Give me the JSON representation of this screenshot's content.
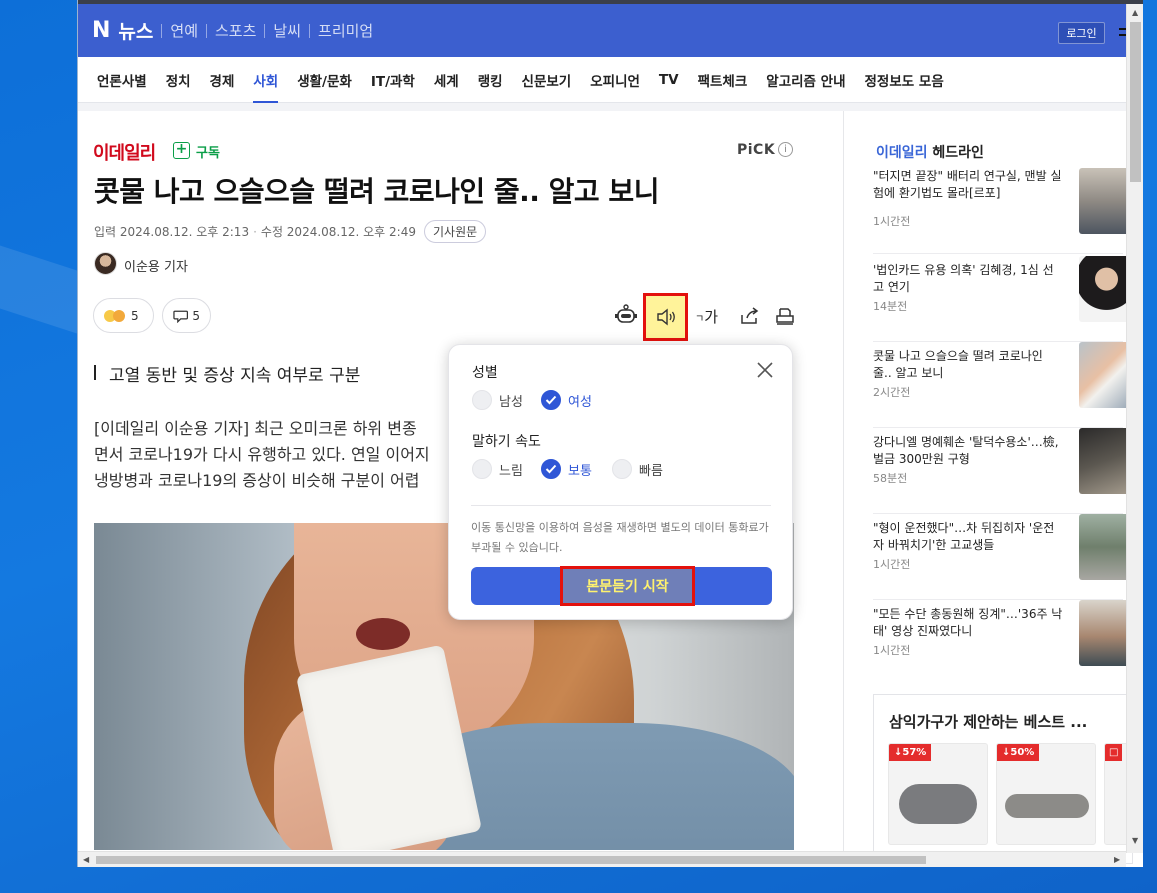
{
  "header": {
    "logo_mark": "N",
    "logo_text": "뉴스",
    "top_nav": [
      "연예",
      "스포츠",
      "날씨",
      "프리미엄"
    ],
    "login_label": "로그인"
  },
  "categories": [
    {
      "label": "언론사별",
      "active": false
    },
    {
      "label": "정치",
      "active": false
    },
    {
      "label": "경제",
      "active": false
    },
    {
      "label": "사회",
      "active": true
    },
    {
      "label": "생활/문화",
      "active": false
    },
    {
      "label": "IT/과학",
      "active": false
    },
    {
      "label": "세계",
      "active": false
    },
    {
      "label": "랭킹",
      "active": false
    },
    {
      "label": "신문보기",
      "active": false
    },
    {
      "label": "오피니언",
      "active": false
    },
    {
      "label": "TV",
      "active": false
    },
    {
      "label": "팩트체크",
      "active": false
    },
    {
      "label": "알고리즘 안내",
      "active": false
    },
    {
      "label": "정정보도 모음",
      "active": false
    }
  ],
  "article": {
    "press": "이데일리",
    "subscribe_label": "구독",
    "pick_label": "PiCK",
    "pick_info": "i",
    "headline": "콧물 나고 으슬으슬 떨려 코로나인 줄.. 알고 보니",
    "input_date": "입력 2024.08.12. 오후 2:13",
    "edit_date": "수정 2024.08.12. 오후 2:49",
    "original_label": "기사원문",
    "reporter": "이순용 기자",
    "reaction_count": "5",
    "comment_count": "5",
    "fontsize_label": "가",
    "subheading": "고열 동반 및 증상 지속 여부로 구분",
    "body_lines": [
      "[이데일리 이순용 기자] 최근 오미크론 하위 변종",
      "면서 코로나19가 다시 유행하고 있다. 연일 이어지",
      "냉방병과 코로나19의 증상이 비슷해 구분이 어렵"
    ]
  },
  "tts_popup": {
    "gender_label": "성별",
    "gender_options": [
      {
        "label": "남성",
        "selected": false
      },
      {
        "label": "여성",
        "selected": true
      }
    ],
    "speed_label": "말하기 속도",
    "speed_options": [
      {
        "label": "느림",
        "selected": false
      },
      {
        "label": "보통",
        "selected": true
      },
      {
        "label": "빠름",
        "selected": false
      }
    ],
    "notice": "이동 통신망을 이용하여 음성을 재생하면 별도의 데이터 통화료가 부과될 수 있습니다.",
    "start_label": "본문듣기 시작"
  },
  "sidebar": {
    "press": "이데일리",
    "title": "헤드라인",
    "items": [
      {
        "title": "\"터지면 끝장\" 배터리 연구실, 맨발 실험에 환기법도 몰라[르포]",
        "time": "1시간전"
      },
      {
        "title": "'법인카드 유용 의혹' 김혜경, 1심 선고 연기",
        "time": "14분전"
      },
      {
        "title": "콧물 나고 으슬으슬 떨려 코로나인 줄.. 알고 보니",
        "time": "2시간전"
      },
      {
        "title": "강다니엘 명예훼손 '탈덕수용소'…檢, 벌금 300만원 구형",
        "time": "58분전"
      },
      {
        "title": "\"형이 운전했다\"…차 뒤집히자 '운전자 바꿔치기'한 고교생들",
        "time": "1시간전"
      },
      {
        "title": "\"모든 수단 총동원해 징계\"…'36주 낙태' 영상 진짜였다니",
        "time": "1시간전"
      }
    ],
    "ad_title": "삼익가구가 제안하는 베스트 ...",
    "ad_badges": [
      "↓57%",
      "↓50%"
    ]
  },
  "colors": {
    "naver_blue": "#3c5fcf",
    "accent_blue": "#2f56d6",
    "highlight_red": "#e3110d",
    "press_red": "#d10a1d",
    "subscribe_green": "#0b9e48"
  }
}
